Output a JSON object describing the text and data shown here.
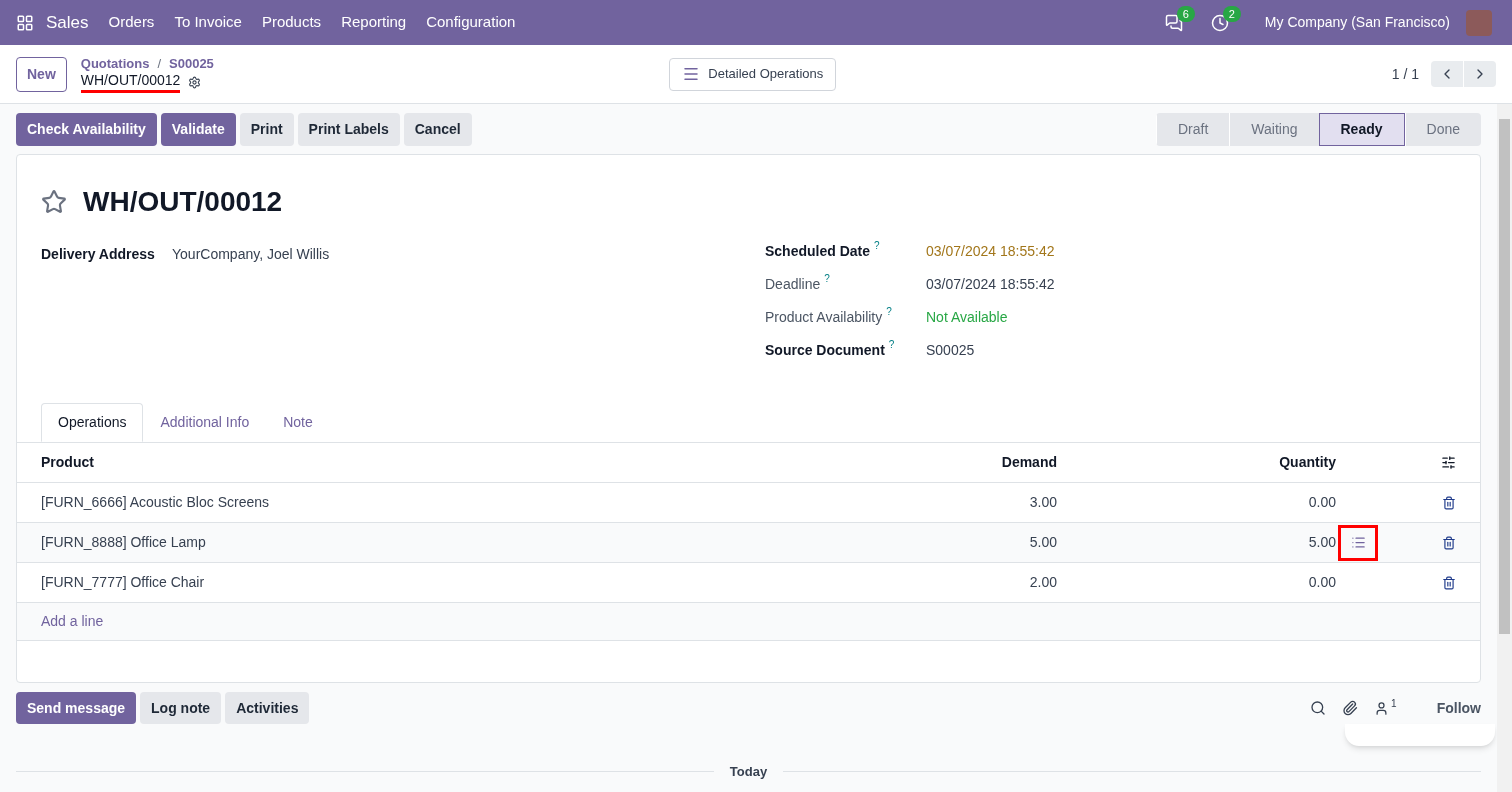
{
  "navbar": {
    "app": "Sales",
    "menus": [
      "Orders",
      "To Invoice",
      "Products",
      "Reporting",
      "Configuration"
    ],
    "messages_count": "6",
    "activities_count": "2",
    "company": "My Company (San Francisco)"
  },
  "control_panel": {
    "new_button": "New",
    "breadcrumbs": [
      "Quotations",
      "S00025"
    ],
    "breadcrumb_separator": "/",
    "record": "WH/OUT/00012",
    "center_button": "Detailed Operations",
    "pager": "1 / 1"
  },
  "actions": [
    {
      "label": "Check Availability",
      "primary": true
    },
    {
      "label": "Validate",
      "primary": true
    },
    {
      "label": "Print",
      "primary": false
    },
    {
      "label": "Print Labels",
      "primary": false
    },
    {
      "label": "Cancel",
      "primary": false
    }
  ],
  "stages": [
    {
      "label": "Draft",
      "selected": false
    },
    {
      "label": "Waiting",
      "selected": false
    },
    {
      "label": "Ready",
      "selected": true
    },
    {
      "label": "Done",
      "selected": false
    }
  ],
  "form": {
    "title": "WH/OUT/00012",
    "starred": false,
    "left_fields": [
      {
        "label": "Delivery Address",
        "value": "YourCompany, Joel Willis",
        "bold": true
      }
    ],
    "right_fields": [
      {
        "label": "Scheduled Date",
        "help": "?",
        "value": "03/07/2024 18:55:42",
        "bold": true,
        "color": "#a2761a"
      },
      {
        "label": "Deadline",
        "help": "?",
        "value": "03/07/2024 18:55:42",
        "bold": false,
        "color": "#374151"
      },
      {
        "label": "Product Availability",
        "help": "?",
        "value": "Not Available",
        "bold": false,
        "color": "#28a745"
      },
      {
        "label": "Source Document",
        "help": "?",
        "value": "S00025",
        "bold": true,
        "color": "#374151"
      }
    ],
    "tabs": [
      {
        "label": "Operations",
        "selected": true
      },
      {
        "label": "Additional Info",
        "selected": false
      },
      {
        "label": "Note",
        "selected": false
      }
    ],
    "table": {
      "columns": [
        "Product",
        "Demand",
        "Quantity"
      ],
      "rows": [
        {
          "product": "[FURN_6666] Acoustic Bloc Screens",
          "demand": "3.00",
          "quantity": "0.00",
          "details_icon": false
        },
        {
          "product": "[FURN_8888] Office Lamp",
          "demand": "5.00",
          "quantity": "5.00",
          "details_icon": true
        },
        {
          "product": "[FURN_7777] Office Chair",
          "demand": "2.00",
          "quantity": "0.00",
          "details_icon": false
        }
      ],
      "add_line": "Add a line"
    }
  },
  "chatter": {
    "buttons": [
      {
        "label": "Send message",
        "primary": true
      },
      {
        "label": "Log note",
        "primary": false
      },
      {
        "label": "Activities",
        "primary": false
      }
    ],
    "followers_count": "1",
    "follow": "Follow",
    "separator": "Today"
  }
}
